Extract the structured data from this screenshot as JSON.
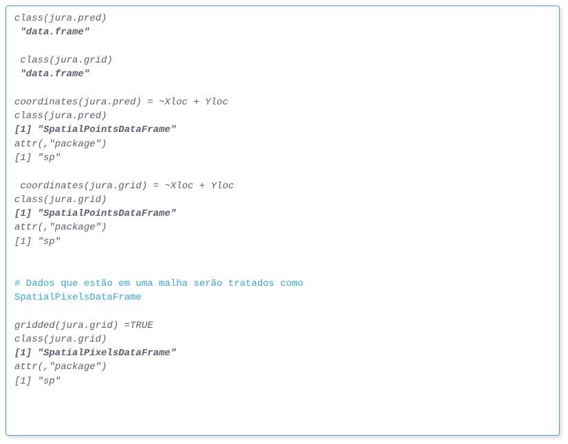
{
  "code": {
    "lines": [
      {
        "text": "class(jura.pred)",
        "bold": false,
        "comment": false
      },
      {
        "text": " \"data.frame\"",
        "bold": true,
        "comment": false
      },
      {
        "text": "",
        "bold": false,
        "comment": false
      },
      {
        "text": " class(jura.grid)",
        "bold": false,
        "comment": false
      },
      {
        "text": " \"data.frame\"",
        "bold": true,
        "comment": false
      },
      {
        "text": "",
        "bold": false,
        "comment": false
      },
      {
        "text": "coordinates(jura.pred) = ~Xloc + Yloc",
        "bold": false,
        "comment": false
      },
      {
        "text": "class(jura.pred)",
        "bold": false,
        "comment": false
      },
      {
        "text": "[1] \"SpatialPointsDataFrame\"",
        "bold": true,
        "comment": false
      },
      {
        "text": "attr(,\"package\")",
        "bold": false,
        "comment": false
      },
      {
        "text": "[1] \"sp\"",
        "bold": false,
        "comment": false
      },
      {
        "text": "",
        "bold": false,
        "comment": false
      },
      {
        "text": " coordinates(jura.grid) = ~Xloc + Yloc",
        "bold": false,
        "comment": false
      },
      {
        "text": "class(jura.grid)",
        "bold": false,
        "comment": false
      },
      {
        "text": "[1] \"SpatialPointsDataFrame\"",
        "bold": true,
        "comment": false
      },
      {
        "text": "attr(,\"package\")",
        "bold": false,
        "comment": false
      },
      {
        "text": "[1] \"sp\"",
        "bold": false,
        "comment": false
      },
      {
        "text": "",
        "bold": false,
        "comment": false
      },
      {
        "text": "",
        "bold": false,
        "comment": false
      },
      {
        "text": "# Dados que estão em uma malha serão tratados como",
        "bold": false,
        "comment": true
      },
      {
        "text": "SpatialPixelsDataFrame",
        "bold": false,
        "comment": true
      },
      {
        "text": "",
        "bold": false,
        "comment": false
      },
      {
        "text": "gridded(jura.grid) =TRUE",
        "bold": false,
        "comment": false
      },
      {
        "text": "class(jura.grid)",
        "bold": false,
        "comment": false
      },
      {
        "text": "[1] \"SpatialPixelsDataFrame\"",
        "bold": true,
        "comment": false
      },
      {
        "text": "attr(,\"package\")",
        "bold": false,
        "comment": false
      },
      {
        "text": "[1] \"sp\"",
        "bold": false,
        "comment": false
      }
    ]
  }
}
